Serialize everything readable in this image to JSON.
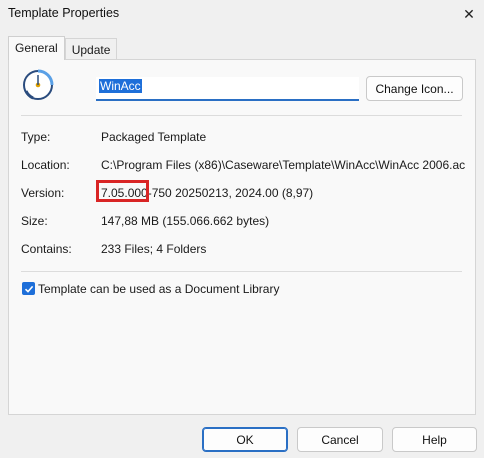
{
  "window": {
    "title": "Template Properties",
    "close_glyph": "✕"
  },
  "tabs": [
    {
      "label": "General",
      "active": true
    },
    {
      "label": "Update",
      "active": false
    }
  ],
  "general": {
    "template_icon": "template-gauge-icon",
    "name_value": "WinAcc",
    "change_icon_label": "Change Icon...",
    "fields": {
      "type": {
        "label": "Type:",
        "value": "Packaged Template"
      },
      "location": {
        "label": "Location:",
        "value": "C:\\Program Files (x86)\\Caseware\\Template\\WinAcc\\WinAcc 2006.ac"
      },
      "version": {
        "label": "Version:",
        "value": "7.05.000-750 20250213, 2024.00 (8,97)"
      },
      "size": {
        "label": "Size:",
        "value": "147,88 MB (155.066.662 bytes)"
      },
      "contains": {
        "label": "Contains:",
        "value": "233 Files; 4 Folders"
      }
    },
    "document_library": {
      "label": "Template can be used as a Document Library",
      "checked": true
    }
  },
  "buttons": {
    "ok": "OK",
    "cancel": "Cancel",
    "help": "Help"
  },
  "colors": {
    "accent": "#1e6fd9",
    "highlight": "#d92525",
    "window_bg": "#f0f0f0",
    "panel_bg": "#f9f9f9"
  }
}
